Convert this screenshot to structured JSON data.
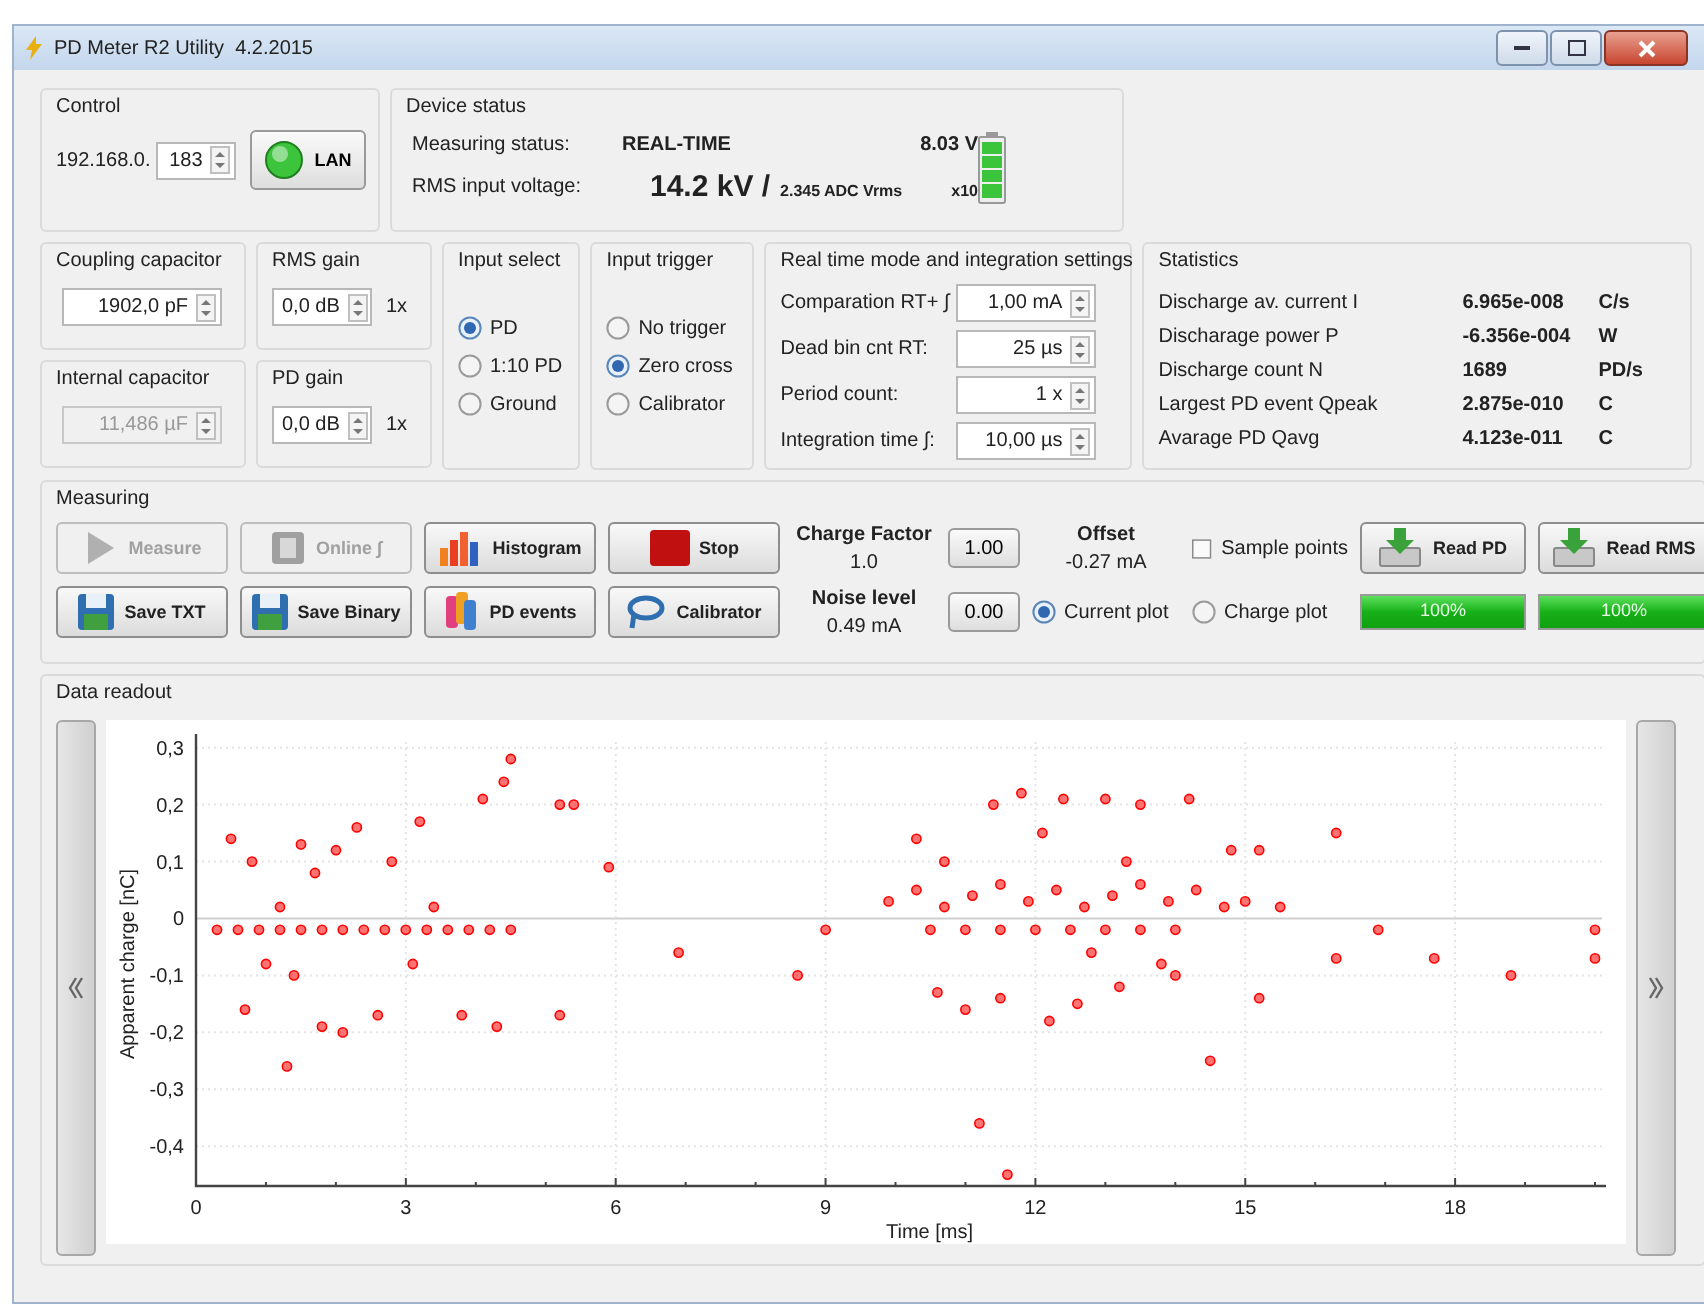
{
  "window": {
    "title": "PD Meter R2 Utility  4.2.2015"
  },
  "control": {
    "title": "Control",
    "ip_prefix": "192.168.0.",
    "ip_last": "183",
    "lan_button": "LAN",
    "lan_on": true
  },
  "device_status": {
    "title": "Device status",
    "status_label": "Measuring status:",
    "status_value": "REAL-TIME",
    "battery_voltage": "8.03 V",
    "rms_label": "RMS input voltage:",
    "rms_value": "14.2 kV /",
    "adc_value": "2.345 ADC Vrms",
    "range": "x10"
  },
  "coupling_capacitor": {
    "title": "Coupling capacitor",
    "value": "1902,0 pF",
    "disabled": false
  },
  "internal_capacitor": {
    "title": "Internal capacitor",
    "value": "11,486 µF",
    "disabled": true
  },
  "rms_gain": {
    "title": "RMS gain",
    "value": "0,0 dB",
    "multiplier": "1x"
  },
  "pd_gain": {
    "title": "PD gain",
    "value": "0,0 dB",
    "multiplier": "1x"
  },
  "input_select": {
    "title": "Input select",
    "options": [
      {
        "label": "PD",
        "selected": true
      },
      {
        "label": "1:10 PD",
        "selected": false
      },
      {
        "label": "Ground",
        "selected": false
      }
    ]
  },
  "input_trigger": {
    "title": "Input trigger",
    "options": [
      {
        "label": "No trigger",
        "selected": false
      },
      {
        "label": "Zero cross",
        "selected": true
      },
      {
        "label": "Calibrator",
        "selected": false
      }
    ]
  },
  "realtime": {
    "title": "Real time mode and integration settings",
    "fields": [
      {
        "label": "Comparation RT+ ∫",
        "value": "1,00 mA"
      },
      {
        "label": "Dead bin cnt RT:",
        "value": "25 µs"
      },
      {
        "label": "Period count:",
        "value": "1 x"
      },
      {
        "label": "Integration time  ∫:",
        "value": "10,00 µs"
      }
    ]
  },
  "statistics": {
    "title": "Statistics",
    "rows": [
      {
        "label": "Discharge av. current I",
        "value": "6.965e-008",
        "unit": "C/s"
      },
      {
        "label": "Discharage power P",
        "value": "-6.356e-004",
        "unit": "W"
      },
      {
        "label": "Discharge count N",
        "value": "1689",
        "unit": "PD/s"
      },
      {
        "label": "Largest PD event Qpeak",
        "value": "2.875e-010",
        "unit": "C"
      },
      {
        "label": "Avarage PD Qavg",
        "value": "4.123e-011",
        "unit": "C"
      }
    ]
  },
  "measuring": {
    "title": "Measuring",
    "buttons": [
      {
        "label": "Measure",
        "kind": "play",
        "disabled": true
      },
      {
        "label": "Online ∫",
        "kind": "integral",
        "disabled": true
      },
      {
        "label": "Histogram",
        "kind": "histogram",
        "disabled": false
      },
      {
        "label": "Stop",
        "kind": "stop",
        "disabled": false
      },
      {
        "label": "Save TXT",
        "kind": "save",
        "disabled": false
      },
      {
        "label": "Save Binary",
        "kind": "save",
        "disabled": false
      },
      {
        "label": "PD events",
        "kind": "events",
        "disabled": false
      },
      {
        "label": "Calibrator",
        "kind": "calibrator",
        "disabled": false
      }
    ],
    "charge_factor": {
      "label": "Charge Factor",
      "reading": "1.0",
      "value": "1.00"
    },
    "noise_level": {
      "label": "Noise level",
      "reading": "0.49 mA",
      "value": "0.00"
    },
    "offset": {
      "label": "Offset",
      "reading": "-0.27 mA"
    },
    "sample_points": {
      "label": "Sample points",
      "checked": false
    },
    "plot_mode": [
      {
        "label": "Current plot",
        "selected": true
      },
      {
        "label": "Charge plot",
        "selected": false
      }
    ],
    "read_buttons": [
      {
        "label": "Read PD",
        "level": 1,
        "reading": "100%"
      },
      {
        "label": "Read RMS",
        "level": 1,
        "reading": "100%"
      }
    ]
  },
  "data_readout": {
    "title": "Data readout",
    "chart_data": {
      "type": "scatter",
      "xlabel": "Time [ms]",
      "ylabel": "Apparent charge [nC]",
      "xlim": [
        0,
        20.1
      ],
      "ylim": [
        -0.47,
        0.31
      ],
      "grid": true,
      "xticks": [
        0,
        3,
        6,
        9,
        12,
        15,
        18
      ],
      "yticks": [
        {
          "value": 0.3,
          "label": "0,3"
        },
        {
          "value": 0.2,
          "label": "0,2"
        },
        {
          "value": 0.1,
          "label": "0,1"
        },
        {
          "value": 0,
          "label": "0"
        },
        {
          "value": -0.1,
          "label": "-0,1"
        },
        {
          "value": -0.2,
          "label": "-0,2"
        },
        {
          "value": -0.3,
          "label": "-0,3"
        },
        {
          "value": -0.4,
          "label": "-0,4"
        }
      ],
      "x": [
        0.3,
        0.6,
        0.9,
        1.2,
        1.5,
        1.8,
        2.1,
        2.4,
        2.7,
        3.0,
        3.3,
        3.6,
        3.9,
        4.2,
        4.5,
        0.5,
        0.8,
        1.0,
        1.2,
        1.4,
        1.5,
        1.8,
        2.0,
        2.3,
        2.6,
        2.8,
        3.2,
        3.4,
        3.8,
        4.1,
        4.4,
        4.5,
        4.3,
        5.2,
        5.4,
        5.2,
        5.9,
        6.9,
        1.3,
        0.7,
        2.1,
        1.7,
        3.1,
        9.0,
        8.6,
        9.9,
        10.3,
        10.7,
        11.1,
        11.5,
        11.9,
        12.3,
        12.7,
        13.1,
        13.5,
        13.9,
        14.3,
        14.7,
        15.0,
        10.5,
        11.0,
        11.5,
        12.0,
        12.5,
        13.0,
        13.5,
        14.0,
        10.3,
        10.7,
        11.4,
        11.8,
        12.4,
        13.0,
        13.5,
        14.2,
        14.8,
        15.2,
        16.3,
        12.1,
        13.3,
        11.0,
        11.5,
        12.2,
        12.6,
        13.2,
        14.0,
        14.5,
        11.2,
        11.6,
        10.6,
        15.2,
        16.3,
        16.9,
        17.7,
        18.8,
        20.0,
        20.0,
        15.5,
        12.8,
        13.8
      ],
      "series": [
        {
          "color": "#ff0000",
          "values": [
            -0.02,
            -0.02,
            -0.02,
            -0.02,
            -0.02,
            -0.02,
            -0.02,
            -0.02,
            -0.02,
            -0.02,
            -0.02,
            -0.02,
            -0.02,
            -0.02,
            -0.02,
            0.14,
            0.1,
            -0.08,
            0.02,
            -0.1,
            0.13,
            -0.19,
            0.12,
            0.16,
            -0.17,
            0.1,
            0.17,
            0.02,
            -0.17,
            0.21,
            0.24,
            0.28,
            -0.19,
            0.2,
            0.2,
            -0.17,
            0.09,
            -0.06,
            -0.26,
            -0.16,
            -0.2,
            0.08,
            -0.08,
            -0.02,
            -0.1,
            0.03,
            0.05,
            0.02,
            0.04,
            0.06,
            0.03,
            0.05,
            0.02,
            0.04,
            0.06,
            0.03,
            0.05,
            0.02,
            0.03,
            -0.02,
            -0.02,
            -0.02,
            -0.02,
            -0.02,
            -0.02,
            -0.02,
            -0.02,
            0.14,
            0.1,
            0.2,
            0.22,
            0.21,
            0.21,
            0.2,
            0.21,
            0.12,
            0.12,
            0.15,
            0.15,
            0.1,
            -0.16,
            -0.14,
            -0.18,
            -0.15,
            -0.12,
            -0.1,
            -0.25,
            -0.36,
            -0.45,
            -0.13,
            -0.14,
            -0.07,
            -0.02,
            -0.07,
            -0.1,
            -0.02,
            -0.07,
            0.02,
            -0.06,
            -0.08
          ]
        }
      ]
    }
  }
}
